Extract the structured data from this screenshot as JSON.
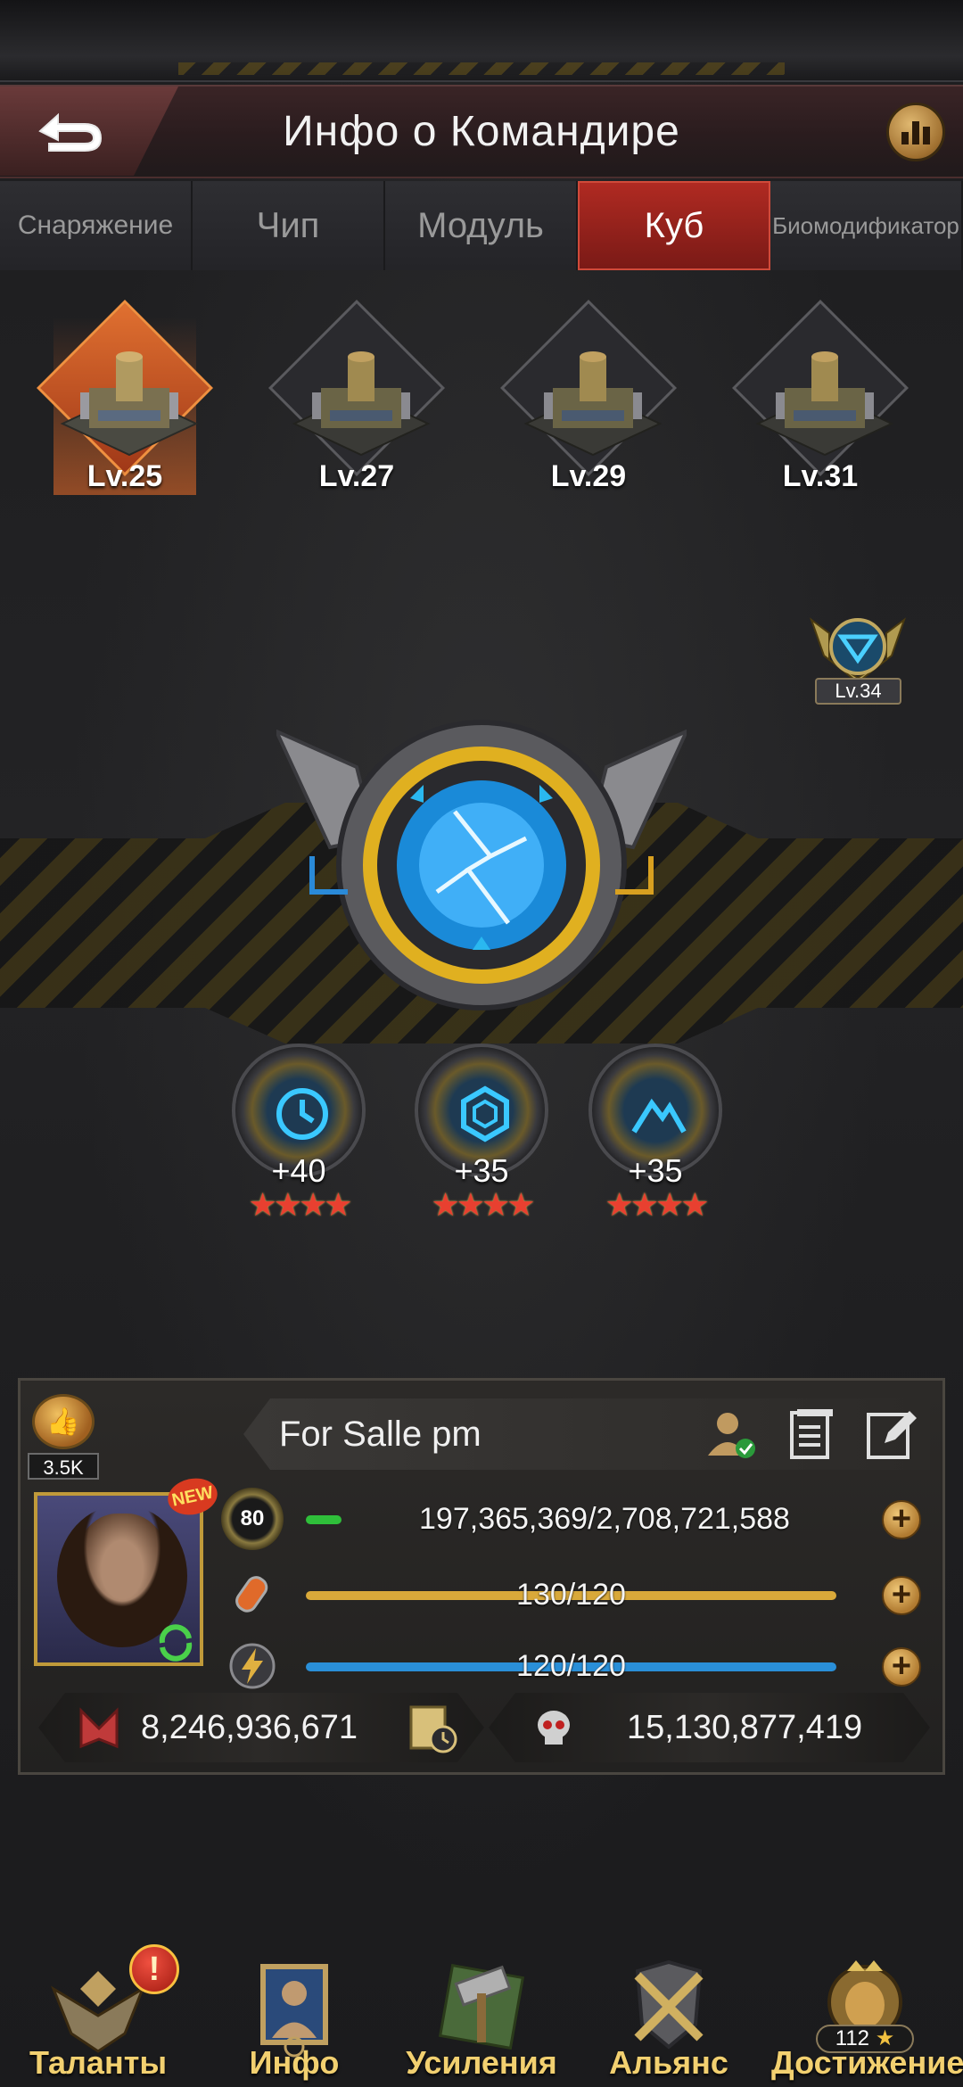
{
  "header": {
    "title": "Инфо о Командире"
  },
  "tabs": [
    {
      "label": "Снаряжение",
      "active": false
    },
    {
      "label": "Чип",
      "active": false
    },
    {
      "label": "Модуль",
      "active": false
    },
    {
      "label": "Куб",
      "active": true
    },
    {
      "label": "Биомодификатор",
      "active": false
    }
  ],
  "buildings": [
    {
      "level": "Lv.25",
      "selected": true
    },
    {
      "level": "Lv.27",
      "selected": false
    },
    {
      "level": "Lv.29",
      "selected": false
    },
    {
      "level": "Lv.31",
      "selected": false
    }
  ],
  "badge": {
    "level": "Lv.34"
  },
  "perks": [
    {
      "icon": "clock-gear-icon",
      "value": "+40",
      "stars": "★★★★",
      "star_count": 4
    },
    {
      "icon": "hexagon-icon",
      "value": "+35",
      "stars": "★★★★",
      "star_count": 4
    },
    {
      "icon": "mountain-icon",
      "value": "+35",
      "stars": "★★★★",
      "star_count": 4
    }
  ],
  "commander": {
    "likes": "3.5K",
    "name": "For Salle pm",
    "new_badge": "NEW",
    "level": "80",
    "exp_text": "197,365,369/2,708,721,588",
    "exp_fraction": 0.0729,
    "stamina_text": "130/120",
    "stamina_fraction": 1.0,
    "energy_text": "120/120",
    "energy_fraction": 1.0,
    "plus": "+",
    "power": "8,246,936,671",
    "kills": "15,130,877,419"
  },
  "bottom_nav": [
    {
      "label": "Таланты",
      "alert": "!"
    },
    {
      "label": "Инфо"
    },
    {
      "label": "Усиления"
    },
    {
      "label": "Альянс"
    },
    {
      "label": "Достижение",
      "count": "112",
      "star": "★"
    }
  ],
  "colors": {
    "accent_red": "#b02a22",
    "gold": "#f2d070",
    "exp_green": "#2fbf3a",
    "stamina_gold": "#d9a93a",
    "energy_blue": "#2a8fd8",
    "star_red": "#e84030"
  }
}
